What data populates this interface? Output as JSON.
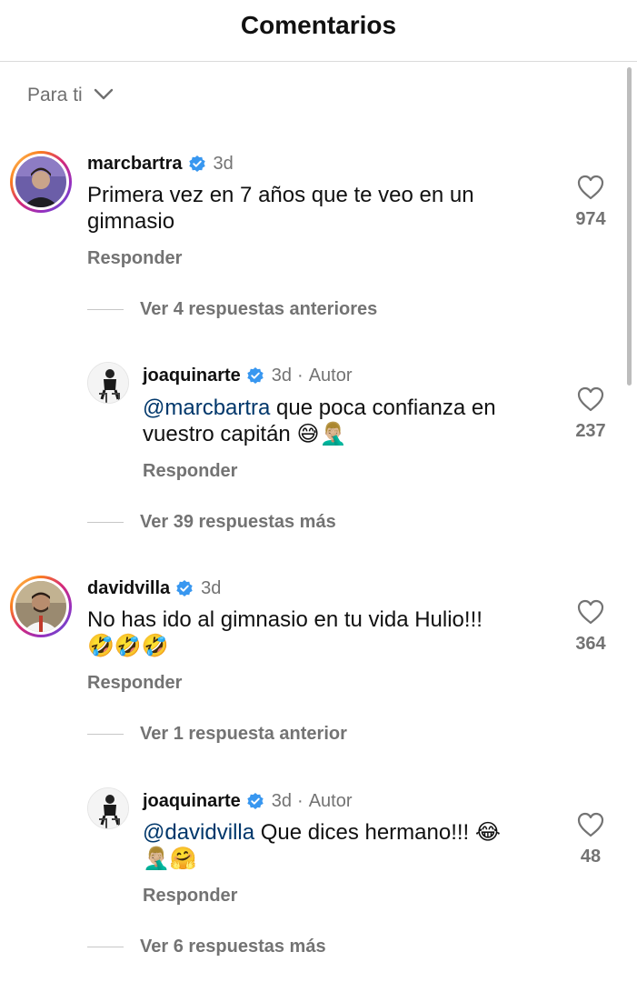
{
  "header": {
    "title": "Comentarios"
  },
  "sort": {
    "label": "Para ti"
  },
  "comments": [
    {
      "username": "marcbartra",
      "time": "3d",
      "text": "Primera vez en 7 años que te veo en un gimnasio",
      "reply_label": "Responder",
      "likes": "974"
    },
    {
      "username": "joaquinarte",
      "time": "3d",
      "author_label": "Autor",
      "mention": "@marcbartra",
      "text": " que poca confianza en vuestro capitán",
      "emoji": "😅🤦🏼‍♂️",
      "reply_label": "Responder",
      "likes": "237"
    },
    {
      "username": "davidvilla",
      "time": "3d",
      "text": "No has ido al gimnasio en tu vida Hulio!!!",
      "emoji": "🤣🤣🤣",
      "reply_label": "Responder",
      "likes": "364"
    },
    {
      "username": "joaquinarte",
      "time": "3d",
      "author_label": "Autor",
      "mention": "@davidvilla",
      "text": " Que dices hermano!!!",
      "emoji_inline": "😂",
      "emoji": "🤦🏼‍♂️🤗",
      "reply_label": "Responder",
      "likes": "48"
    }
  ],
  "view_more": [
    "Ver 4 respuestas anteriores",
    "Ver 39 respuestas más",
    "Ver 1 respuesta anterior",
    "Ver 6 respuestas más"
  ],
  "colors": {
    "verified": "#3897f0",
    "mention": "#00376b",
    "muted": "#737373"
  },
  "icons": [
    "chevron-down-icon",
    "verified-badge-icon",
    "heart-icon"
  ]
}
